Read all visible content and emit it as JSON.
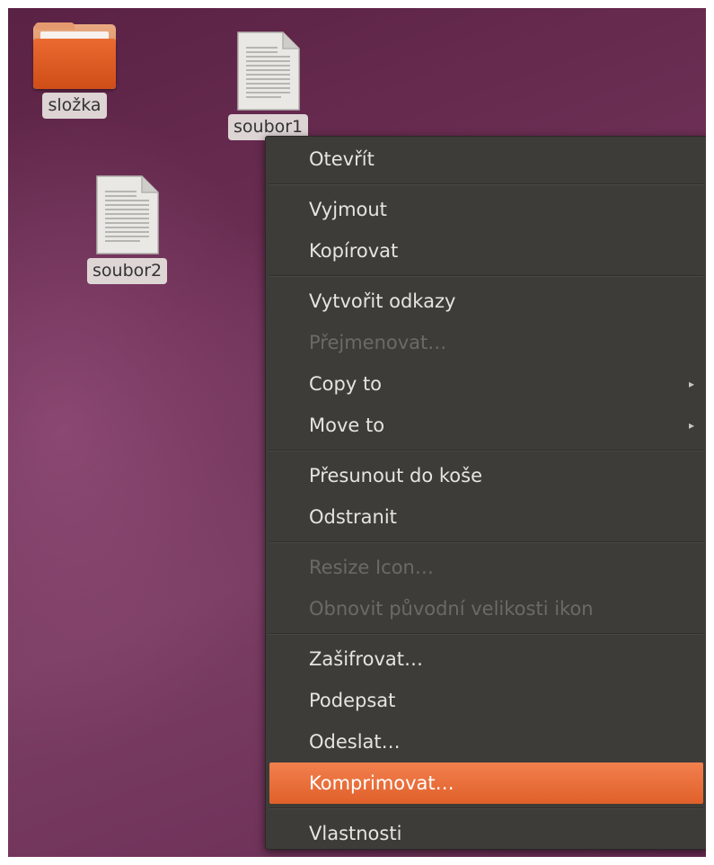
{
  "desktop": {
    "icons": [
      {
        "label": "složka",
        "type": "folder-icon"
      },
      {
        "label": "soubor1",
        "type": "document-icon"
      },
      {
        "label": "soubor2",
        "type": "document-icon"
      }
    ]
  },
  "context_menu": {
    "items": [
      {
        "label": "Otevřít",
        "enabled": true
      },
      {
        "label": "Vyjmout",
        "enabled": true
      },
      {
        "label": "Kopírovat",
        "enabled": true
      },
      {
        "label": "Vytvořit odkazy",
        "enabled": true
      },
      {
        "label": "Přejmenovat…",
        "enabled": false
      },
      {
        "label": "Copy to",
        "enabled": true,
        "submenu": true
      },
      {
        "label": "Move to",
        "enabled": true,
        "submenu": true
      },
      {
        "label": "Přesunout do koše",
        "enabled": true
      },
      {
        "label": "Odstranit",
        "enabled": true
      },
      {
        "label": "Resize Icon…",
        "enabled": false
      },
      {
        "label": "Obnovit původní velikosti ikon",
        "enabled": false
      },
      {
        "label": "Zašifrovat…",
        "enabled": true
      },
      {
        "label": "Podepsat",
        "enabled": true
      },
      {
        "label": "Odeslat…",
        "enabled": true
      },
      {
        "label": "Komprimovat…",
        "enabled": true,
        "highlighted": true
      },
      {
        "label": "Vlastnosti",
        "enabled": true
      }
    ],
    "submenu_arrow": "▸",
    "highlight_color": "#e9683a"
  },
  "colors": {
    "menu_background": "#3d3c38",
    "menu_text": "#e6e4e0",
    "disabled_text": "#6c6a66",
    "desktop_background": "#6d2f55"
  }
}
